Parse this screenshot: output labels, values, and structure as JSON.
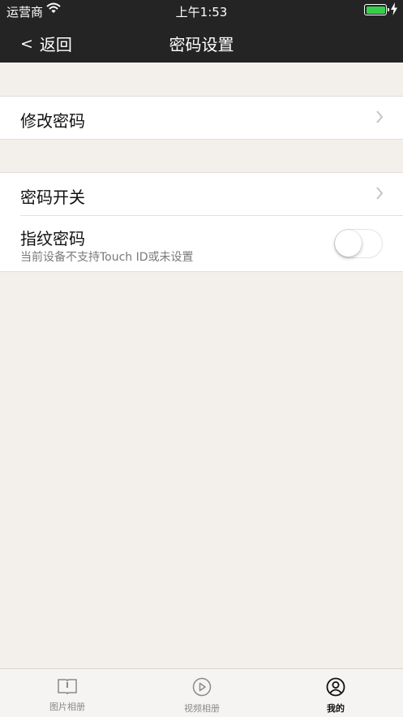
{
  "status_bar": {
    "carrier": "运营商",
    "time": "上午1:53"
  },
  "nav": {
    "back_label": "返回",
    "title": "密码设置"
  },
  "rows": {
    "change_password": "修改密码",
    "password_switch": "密码开关",
    "fingerprint": {
      "label": "指纹密码",
      "subtitle": "当前设备不支持Touch ID或未设置",
      "enabled": false
    }
  },
  "tabs": [
    {
      "label": "图片相册",
      "icon": "book-icon",
      "active": false
    },
    {
      "label": "视频相册",
      "icon": "play-circle-icon",
      "active": false
    },
    {
      "label": "我的",
      "icon": "user-icon",
      "active": true
    }
  ],
  "colors": {
    "header": "#242424",
    "background": "#f3efeb",
    "battery": "#35d04a"
  }
}
